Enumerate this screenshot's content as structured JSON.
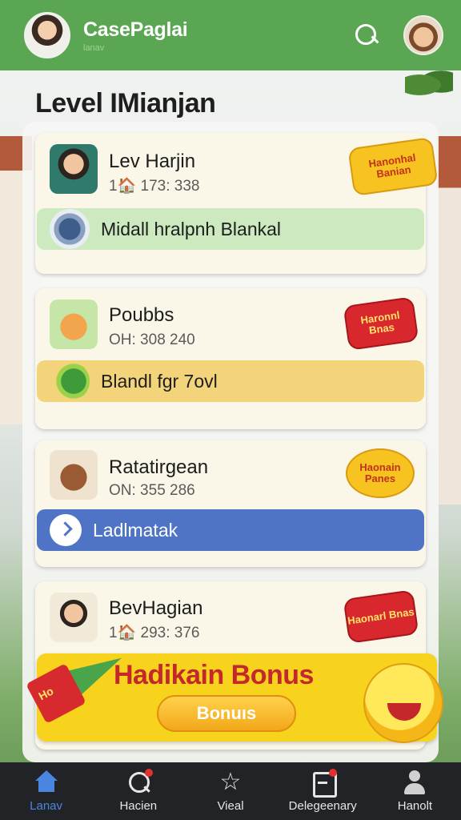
{
  "header": {
    "brand": "CasePaglai",
    "brand_sub": "lanav"
  },
  "page_title": "Level IMianjan",
  "cards": [
    {
      "name": "Lev Harjin",
      "meta": "1🏠 173: 338",
      "badge": "Hanonhal Banian",
      "action_label": "Midall hralpnh Blankal"
    },
    {
      "name": "Poubbs",
      "meta": "OH: 308 240",
      "badge": "Haronnl Bnas",
      "action_label": "Blandl fgr 7ovl"
    },
    {
      "name": "Ratatirgean",
      "meta": "ON: 355 286",
      "badge": "Haonain Panes",
      "action_label": "Ladlmatak"
    },
    {
      "name": "BevHagian",
      "meta": "1🏠 293: 376",
      "badge": "Haonarl Bnas"
    }
  ],
  "promo": {
    "title": "Hadikain Bonus",
    "button": "Bonuıs",
    "megaphone_text": "Ho"
  },
  "nav": [
    {
      "label": "Lanav",
      "active": true
    },
    {
      "label": "Hacien",
      "active": false
    },
    {
      "label": "Vieal",
      "active": false
    },
    {
      "label": "Delegeenary",
      "active": false
    },
    {
      "label": "Hanolt",
      "active": false
    }
  ],
  "colors": {
    "header": "#5aa653",
    "nav_bg": "#222326",
    "nav_active": "#4a86e0",
    "promo": "#f7d31e",
    "action_blue": "#4f74c6"
  }
}
